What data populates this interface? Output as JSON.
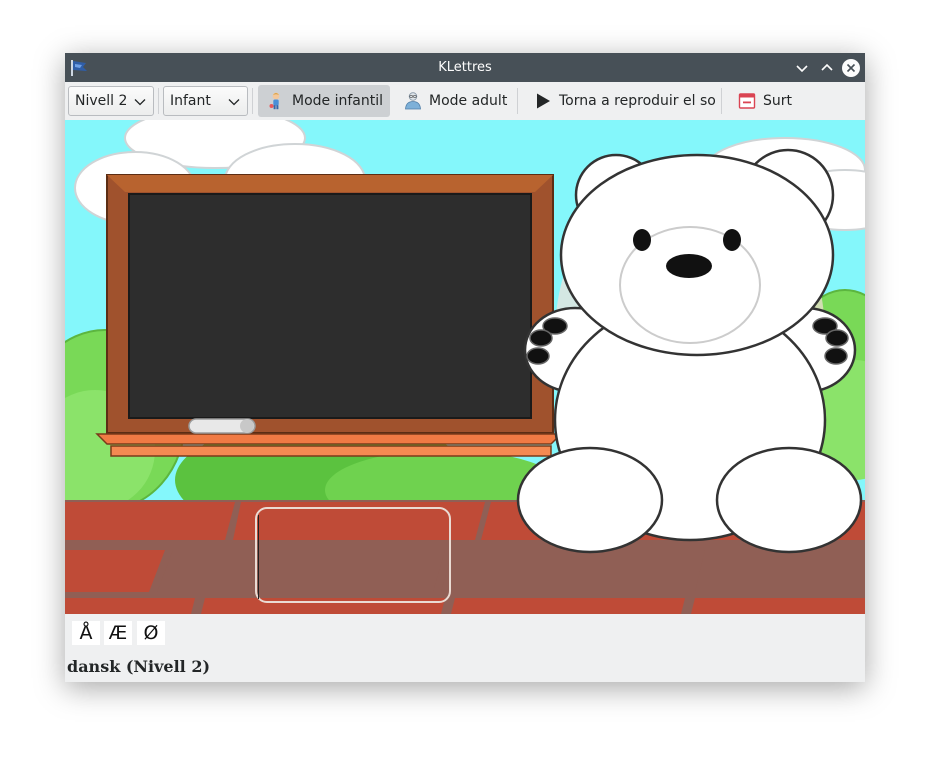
{
  "window": {
    "title": "KLettres",
    "buttons": {
      "minimize": "chevron-down-icon",
      "maximize": "chevron-up-icon",
      "close": "close-icon"
    }
  },
  "toolbar": {
    "level_value": "Nivell 2",
    "mode_value": "Infant",
    "kid_mode_label": "Mode infantil",
    "grownup_mode_label": "Mode adult",
    "replay_label": "Torna a reproduir el so",
    "quit_label": "Surt",
    "active_mode": "Mode infantil"
  },
  "game": {
    "answer_text": "",
    "special_letters": [
      "Å",
      "Æ",
      "Ø"
    ]
  },
  "status": {
    "text": "dansk  (Nivell 2)"
  },
  "colors": {
    "titlebar": "#475057",
    "sky": "#84f7fb",
    "blackboard": "#2d2d2d",
    "frame": "#a0522d",
    "brick": "#bf4b37",
    "grass": "#66cc44"
  }
}
